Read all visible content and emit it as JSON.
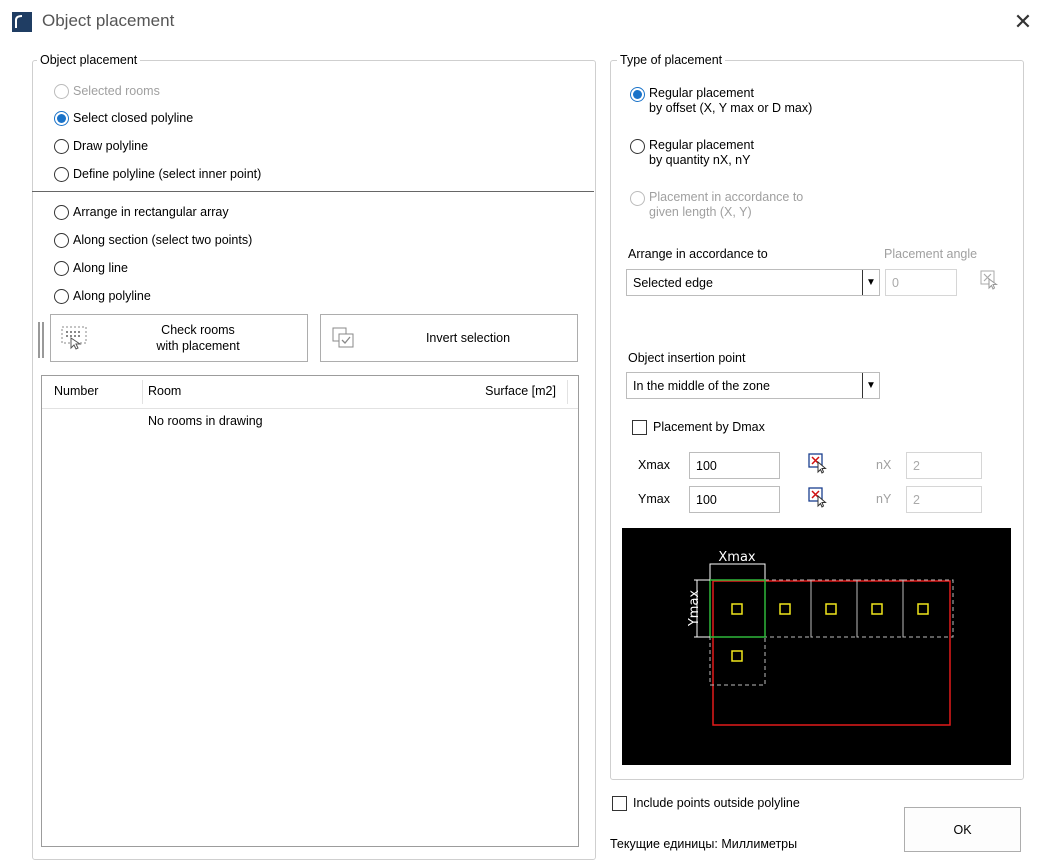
{
  "window": {
    "title": "Object placement",
    "close_glyph": "✕"
  },
  "left_group": {
    "title": "Object placement",
    "options_top": [
      {
        "label": "Selected rooms",
        "state": "disabled"
      },
      {
        "label": "Select closed polyline",
        "state": "checked"
      },
      {
        "label": "Draw polyline",
        "state": "unchecked"
      },
      {
        "label": "Define polyline (select inner point)",
        "state": "unchecked"
      }
    ],
    "options_bottom": [
      {
        "label": "Arrange in rectangular array",
        "state": "unchecked"
      },
      {
        "label": "Along section (select two points)",
        "state": "unchecked"
      },
      {
        "label": "Along line",
        "state": "unchecked"
      },
      {
        "label": "Along polyline",
        "state": "unchecked"
      }
    ],
    "check_rooms_button": "Check rooms\nwith placement",
    "invert_selection_button": "Invert selection",
    "table": {
      "columns": [
        "Number",
        "Room",
        "Surface [m2]"
      ],
      "empty_text": "No rooms in drawing"
    }
  },
  "right_group": {
    "title": "Type of placement",
    "placement_types": [
      {
        "label": "Regular placement\nby offset (X, Y max or D max)",
        "state": "checked"
      },
      {
        "label": "Regular placement\nby quantity nX, nY",
        "state": "unchecked"
      },
      {
        "label": "Placement in accordance to\ngiven length (X, Y)",
        "state": "disabled"
      }
    ],
    "arrange_label": "Arrange in accordance to",
    "arrange_value": "Selected edge",
    "angle_label": "Placement angle",
    "angle_value": "0",
    "insertion_label": "Object insertion point",
    "insertion_value": "In the middle of the zone",
    "dmax_checkbox": "Placement by Dmax",
    "xmax_label": "Xmax",
    "xmax_value": "100",
    "ymax_label": "Ymax",
    "ymax_value": "100",
    "nx_label": "nX",
    "nx_value": "2",
    "ny_label": "nY",
    "ny_value": "2",
    "preview": {
      "xmax_text": "Xmax",
      "ymax_text": "Ymax"
    }
  },
  "footer": {
    "outside_checkbox": "Include points outside polyline",
    "units_text": "Текущие единицы: Миллиметры",
    "ok_button": "OK"
  }
}
